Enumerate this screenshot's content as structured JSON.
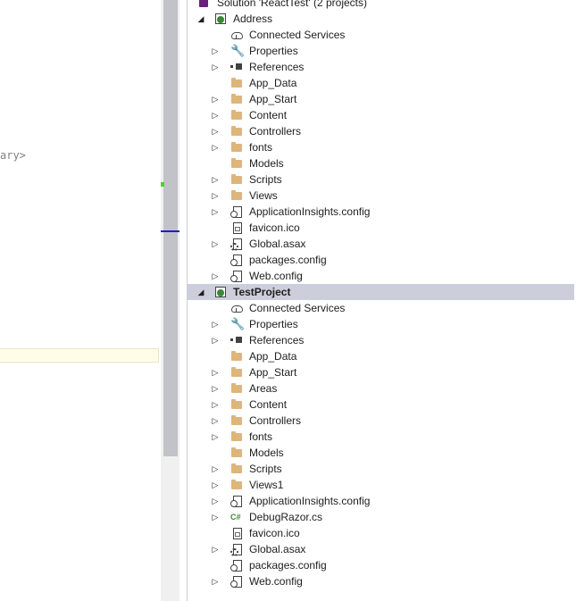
{
  "editor": {
    "code_fragment": "ary>"
  },
  "solution": {
    "label": "Solution 'ReactTest' (2 projects)"
  },
  "projects": [
    {
      "name": "Address",
      "items": [
        {
          "label": "Connected Services",
          "icon": "connected-services-icon",
          "expandable": false
        },
        {
          "label": "Properties",
          "icon": "wrench-icon",
          "expandable": true
        },
        {
          "label": "References",
          "icon": "references-icon",
          "expandable": true
        },
        {
          "label": "App_Data",
          "icon": "folder-icon",
          "expandable": false
        },
        {
          "label": "App_Start",
          "icon": "folder-icon",
          "expandable": true
        },
        {
          "label": "Content",
          "icon": "folder-icon",
          "expandable": true
        },
        {
          "label": "Controllers",
          "icon": "folder-icon",
          "expandable": true
        },
        {
          "label": "fonts",
          "icon": "folder-icon",
          "expandable": true
        },
        {
          "label": "Models",
          "icon": "folder-icon",
          "expandable": false
        },
        {
          "label": "Scripts",
          "icon": "folder-icon",
          "expandable": true
        },
        {
          "label": "Views",
          "icon": "folder-icon",
          "expandable": true
        },
        {
          "label": "ApplicationInsights.config",
          "icon": "config-file-icon",
          "expandable": true
        },
        {
          "label": "favicon.ico",
          "icon": "image-file-icon",
          "expandable": false
        },
        {
          "label": "Global.asax",
          "icon": "asax-file-icon",
          "expandable": true
        },
        {
          "label": "packages.config",
          "icon": "config-file-icon",
          "expandable": false
        },
        {
          "label": "Web.config",
          "icon": "config-file-icon",
          "expandable": true
        }
      ]
    },
    {
      "name": "TestProject",
      "selected": true,
      "items": [
        {
          "label": "Connected Services",
          "icon": "connected-services-icon",
          "expandable": false
        },
        {
          "label": "Properties",
          "icon": "wrench-icon",
          "expandable": true
        },
        {
          "label": "References",
          "icon": "references-icon",
          "expandable": true
        },
        {
          "label": "App_Data",
          "icon": "folder-icon",
          "expandable": false
        },
        {
          "label": "App_Start",
          "icon": "folder-icon",
          "expandable": true
        },
        {
          "label": "Areas",
          "icon": "folder-icon",
          "expandable": true
        },
        {
          "label": "Content",
          "icon": "folder-icon",
          "expandable": true
        },
        {
          "label": "Controllers",
          "icon": "folder-icon",
          "expandable": true
        },
        {
          "label": "fonts",
          "icon": "folder-icon",
          "expandable": true
        },
        {
          "label": "Models",
          "icon": "folder-icon",
          "expandable": false
        },
        {
          "label": "Scripts",
          "icon": "folder-icon",
          "expandable": true
        },
        {
          "label": "Views1",
          "icon": "folder-icon",
          "expandable": true
        },
        {
          "label": "ApplicationInsights.config",
          "icon": "config-file-icon",
          "expandable": true
        },
        {
          "label": "DebugRazor.cs",
          "icon": "csharp-file-icon",
          "expandable": true
        },
        {
          "label": "favicon.ico",
          "icon": "image-file-icon",
          "expandable": false
        },
        {
          "label": "Global.asax",
          "icon": "asax-file-icon",
          "expandable": true
        },
        {
          "label": "packages.config",
          "icon": "config-file-icon",
          "expandable": false
        },
        {
          "label": "Web.config",
          "icon": "config-file-icon",
          "expandable": true
        }
      ]
    }
  ],
  "glyphs": {
    "expanded": "◢",
    "collapsed": "▷",
    "wrench": "🔧",
    "csharp": "C#"
  },
  "colors": {
    "selection": "#cccedb",
    "folder": "#dcb67a",
    "scrollbar_thumb": "#c2c3c9",
    "change_marker": "#4cd12e",
    "caret_marker": "#1d1dc8"
  }
}
